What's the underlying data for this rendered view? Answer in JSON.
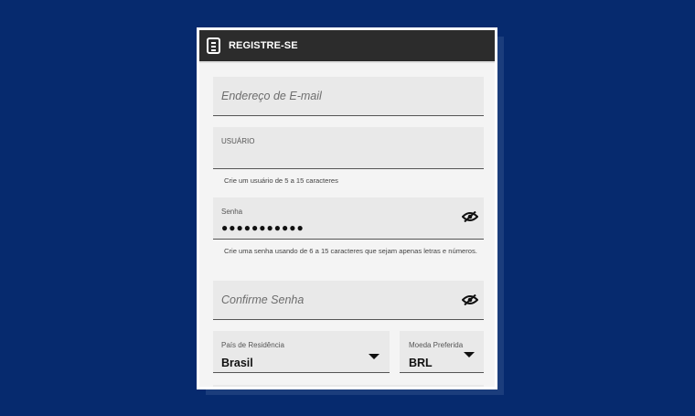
{
  "header": {
    "title": "REGISTRE-SE",
    "icon": "document-icon"
  },
  "form": {
    "email": {
      "placeholder": "Endereço de E-mail"
    },
    "username": {
      "label": "USUÁRIO",
      "hint": "Crie um usuário de 5 a 15 caracteres"
    },
    "password": {
      "label": "Senha",
      "value": "●●●●●●●●●●●",
      "hint": "Crie uma senha usando de 6 a 15 caracteres que sejam apenas letras e números."
    },
    "confirm": {
      "placeholder": "Confirme Senha"
    },
    "country": {
      "label": "País de Residência",
      "value": "Brasil"
    },
    "currency": {
      "label": "Moeda Preferida",
      "value": "BRL"
    }
  },
  "colors": {
    "background": "#062a6e",
    "header": "#2c2c2c",
    "field": "#e9e9e9"
  }
}
